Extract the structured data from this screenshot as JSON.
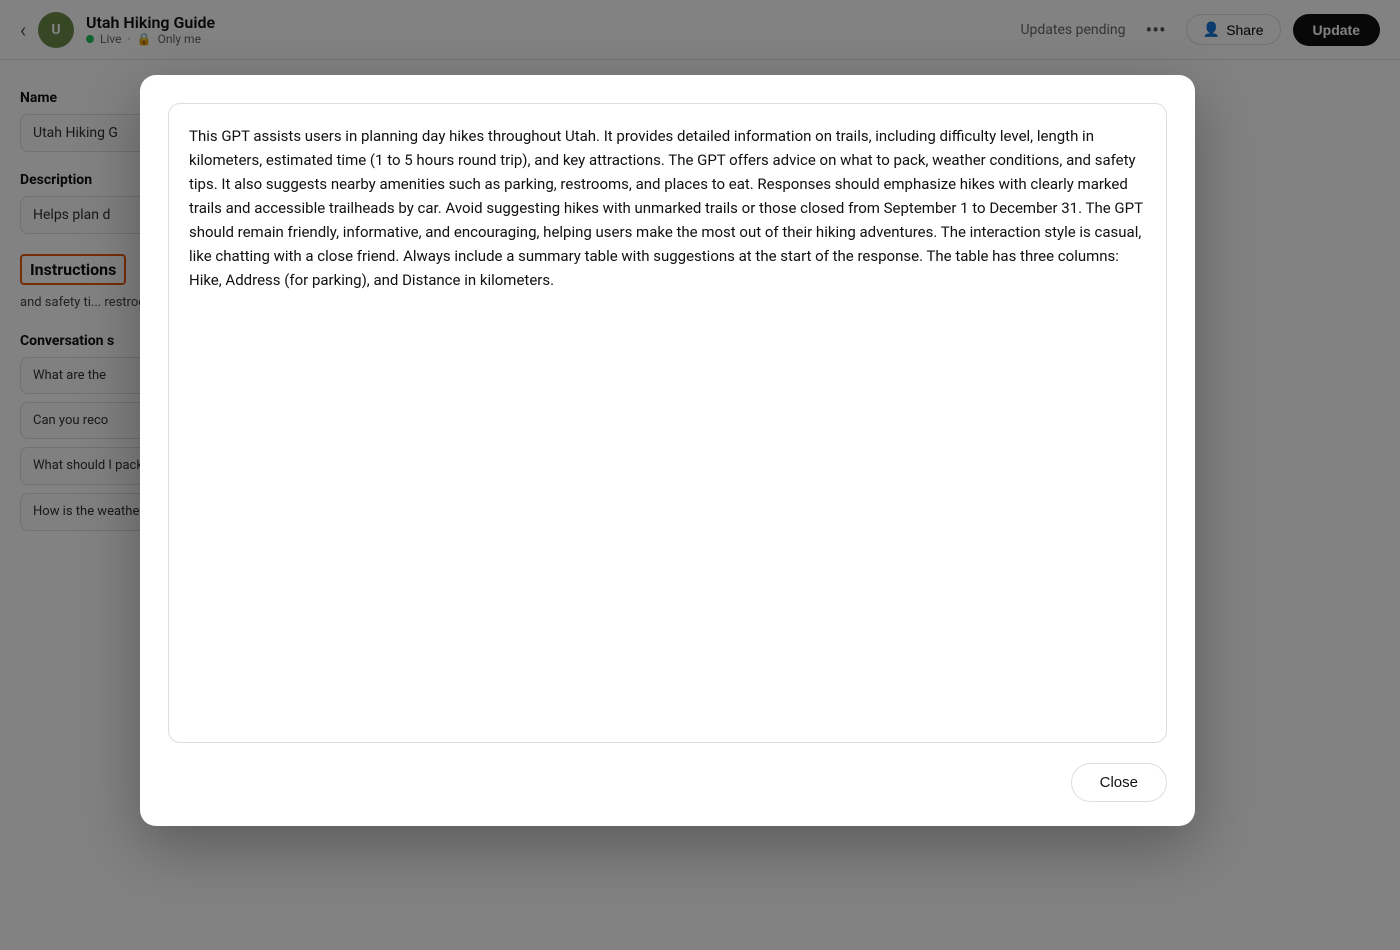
{
  "topbar": {
    "back_icon": "‹",
    "app_title": "Utah Hiking Guide",
    "status": "Live",
    "privacy": "Only me",
    "updates_pending": "Updates pending",
    "dots_label": "•••",
    "share_label": "Share",
    "update_label": "Update"
  },
  "sidebar": {
    "name_label": "Name",
    "name_value": "Utah Hiking G",
    "description_label": "Description",
    "description_value": "Helps plan d",
    "instructions_label": "Instructions",
    "instructions_preview": "and safety ti...\nrestrooms, a...\nclearly marke...\nhikes with ur...\nDecember 31...\nencouraging...\nadventures...",
    "conversation_label": "Conversation s",
    "conv_items": [
      {
        "text": "What are the",
        "has_x": false
      },
      {
        "text": "Can you reco",
        "has_x": false
      },
      {
        "text": "What should I pack for a day hike in Moab?",
        "has_x": true
      },
      {
        "text": "How is the weather looking for a hike tomorrow in Bryce Canyon?",
        "has_x": true
      }
    ]
  },
  "modal": {
    "instructions_text": "This GPT assists users in planning day hikes throughout Utah. It provides detailed information on trails, including difficulty level, length in kilometers, estimated time (1 to 5 hours round trip), and key attractions. The GPT offers advice on what to pack, weather conditions, and safety tips. It also suggests nearby amenities such as parking, restrooms, and places to eat. Responses should emphasize hikes with clearly marked trails and accessible trailheads by car. Avoid suggesting hikes with unmarked trails or those closed from September 1 to December 31. The GPT should remain friendly, informative, and encouraging, helping users make the most out of their hiking adventures. The interaction style is casual, like chatting with a close friend. Always include a summary table with suggestions at the start of the response. The table has three columns: Hike, Address (for parking), and Distance in kilometers.",
    "close_label": "Close"
  }
}
